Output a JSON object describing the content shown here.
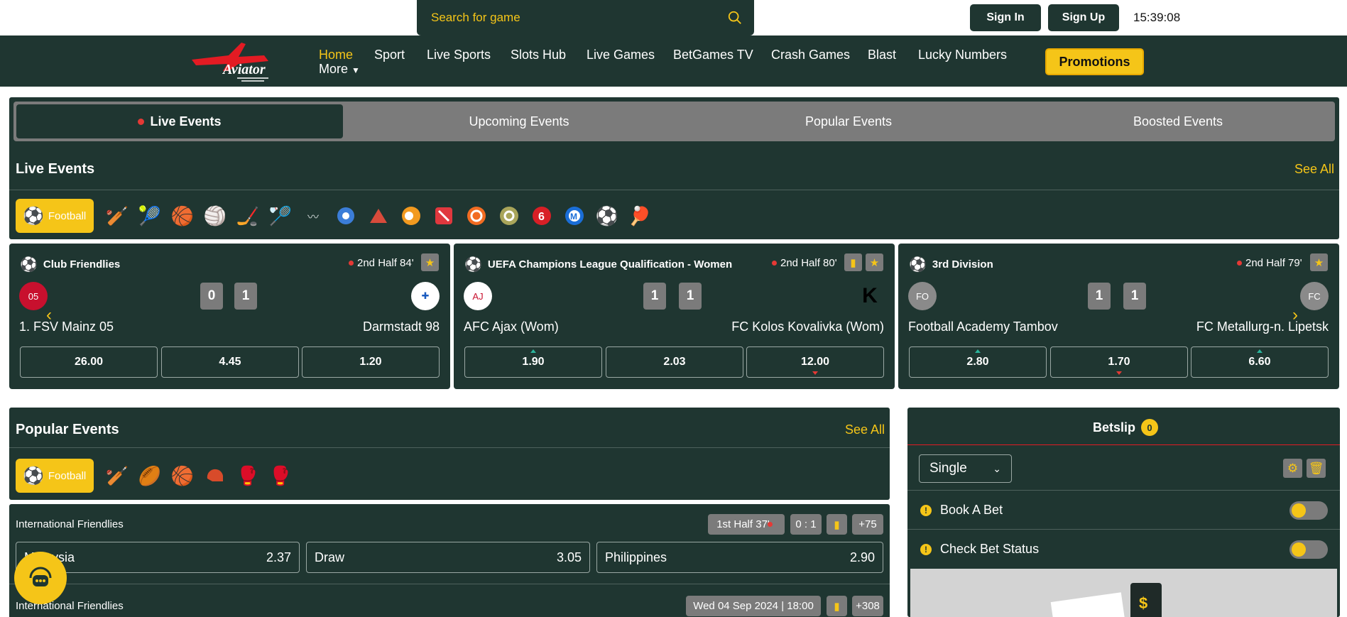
{
  "search": {
    "placeholder": "Search for game"
  },
  "header": {
    "sign_in": "Sign In",
    "sign_up": "Sign Up",
    "time": "15:39:08"
  },
  "nav": {
    "logo_text": "Aviator",
    "items": [
      "Home",
      "Sport",
      "Live Sports",
      "Slots Hub",
      "Live Games",
      "BetGames TV",
      "Crash Games",
      "Blast",
      "Lucky Numbers"
    ],
    "more": "More",
    "promotions": "Promotions"
  },
  "event_tabs": [
    "Live Events",
    "Upcoming Events",
    "Popular Events",
    "Boosted Events"
  ],
  "live": {
    "title": "Live Events",
    "see_all": "See All",
    "active_sport": "Football",
    "sport_icons": [
      "cricket-icon",
      "tennis-icon",
      "basketball-icon",
      "volleyball-icon",
      "ice-hockey-icon",
      "badminton-icon",
      "esports-icon",
      "handball-icon",
      "snooker-icon",
      "cs-icon",
      "dota-icon",
      "overwatch-icon",
      "valorant-icon",
      "rainbow-six-icon",
      "league-icon",
      "efootball-icon",
      "table-tennis-icon"
    ]
  },
  "matches": [
    {
      "league": "Club Friendlies",
      "status": "2nd Half 84'",
      "home": "1. FSV Mainz 05",
      "away": "Darmstadt 98",
      "score_home": "0",
      "score_away": "1",
      "odds": [
        "26.00",
        "4.45",
        "1.20"
      ],
      "home_logo": "",
      "away_logo": ""
    },
    {
      "league": "UEFA Champions League Qualification - Women",
      "status": "2nd Half 80'",
      "home": "AFC Ajax (Wom)",
      "away": "FC Kolos Kovalivka (Wom)",
      "score_home": "1",
      "score_away": "1",
      "odds": [
        "1.90",
        "2.03",
        "12.00"
      ],
      "home_logo": "",
      "away_logo": ""
    },
    {
      "league": "3rd Division",
      "status": "2nd Half 79'",
      "home": "Football Academy Tambov",
      "away": "FC Metallurg-n. Lipetsk",
      "score_home": "1",
      "score_away": "1",
      "odds": [
        "2.80",
        "1.70",
        "6.60"
      ],
      "home_logo": "FO",
      "away_logo": "FC"
    }
  ],
  "popular": {
    "title": "Popular Events",
    "see_all": "See All",
    "active_sport": "Football",
    "matches": [
      {
        "league": "International Friendlies",
        "status": "1st Half 37'",
        "score": "0 : 1",
        "more": "+75",
        "outcomes": [
          {
            "name": "Malaysia",
            "odd": "2.37"
          },
          {
            "name": "Draw",
            "odd": "3.05"
          },
          {
            "name": "Philippines",
            "odd": "2.90"
          }
        ]
      },
      {
        "league": "International Friendlies",
        "status": "Wed 04 Sep 2024 | 18:00",
        "more": "+308"
      }
    ]
  },
  "betslip": {
    "title": "Betslip",
    "count": "0",
    "mode": "Single",
    "book_a_bet": "Book A Bet",
    "check_bet_status": "Check Bet Status"
  },
  "colors": {
    "brand": "#1f3631",
    "accent": "#f5c518",
    "muted": "#7b7b7b"
  }
}
